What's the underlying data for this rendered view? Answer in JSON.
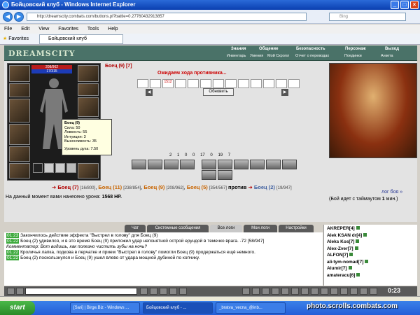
{
  "window": {
    "title": "Бойцовский клуб - Windows Internet Explorer"
  },
  "browser": {
    "address": "http://dreamscity.combats.com/buttons.pl?battle=0.27760432913857",
    "search_placeholder": "Bing",
    "menu": [
      "File",
      "Edit",
      "View",
      "Favorites",
      "Tools",
      "Help"
    ],
    "favorites_label": "Favorites",
    "tab_label": "Бойцовский клуб"
  },
  "game": {
    "logo": "DREAMSCITY",
    "top_menu": [
      "Знания",
      "Общение",
      "Безопасность",
      "Персонаж",
      "Выход"
    ],
    "sub_menu": [
      "Инвентарь",
      "Умения",
      "Мой Скролл",
      "Отчет о переводах",
      "Поединки",
      "Анкета"
    ],
    "char": {
      "hp": "208/962",
      "mp": "17/315",
      "hp_fraction": 0.216,
      "mp_fraction": 0.054
    },
    "tooltip": {
      "name": "Боец (9)",
      "lines": [
        "Сила: 50",
        "Ловкость: 55",
        "Интуиция: 3",
        "Выносливость: 35",
        "",
        "Уровень духа: 7.50"
      ]
    },
    "self_name": "Боец (9)",
    "self_level_link": "[7]",
    "waiting": "Ожидаем хода противника...",
    "timer_cell": "1512",
    "refresh_label": "Обновить",
    "stats": [
      "2",
      "1",
      "0",
      "0",
      "17",
      "0",
      "19",
      "7"
    ],
    "foes": [
      {
        "name": "Боец (7)",
        "hp": "[16/800]"
      },
      {
        "name": "Боец (11)",
        "hp": "[238/854]"
      },
      {
        "name": "Боец (9)",
        "hp": "[208/962]"
      },
      {
        "name": "Боец (5)",
        "hp": "[354/567]"
      }
    ],
    "versus": "против",
    "opponent": {
      "name": "Боец (2)",
      "hp": "[19/947]"
    },
    "log_link": "лог боя »",
    "timeout_pre": "(Бой идет с таймаутом",
    "timeout_value": "1",
    "timeout_post": "мин.)",
    "damage_label": "На данный момент вами нанесено урона:",
    "damage_value": "1568 HP."
  },
  "chat": {
    "tabs": [
      "Чат",
      "Системные сообщения",
      "Все логи",
      "Мои логи",
      "Настройки"
    ],
    "active_tab": 2,
    "lines": [
      {
        "ts": "01:23",
        "text": "Закончилось действие эффекта \"Выстрел в голову\" для Боец (9)"
      },
      {
        "ts": "01:22",
        "text": "Боец (2) удивился, и в это время Боец (9) приложил удар непонятной острой ерундой в темечко врага. -72 [58/947]"
      },
      {
        "ts": "",
        "text": "Комментатор: Вот видишь, как полезно чистить зубы на ночь?"
      },
      {
        "ts": "01:22",
        "text": "Кроличья лапка, подкова в перчатке и прием \"Выстрел в голову\" помогли Боец (9) продержаться ещё немного."
      },
      {
        "ts": "01:22",
        "text": "Боец (2) поскользнулся и Боец (9) ушел влево от удара мощной дубиной по копчику."
      }
    ]
  },
  "users": [
    "AKREPER[4]",
    "Alek KSAN dr[4]",
    "Aleks Kos[7]",
    "Alex-Zver[7]",
    "ALFON[7]",
    "ali-tym-nomad[7]",
    "Alumir[7]",
    "amateracu[6]"
  ],
  "clock": "0:23",
  "taskbar": {
    "start": "start",
    "items": [
      "[Sari] | Birge.Biz - Windows ...",
      "Бойцовский клуб - ...",
      "_bratva_vecna_@inb..."
    ],
    "watermark": "photo.scrolls.combats.com"
  }
}
